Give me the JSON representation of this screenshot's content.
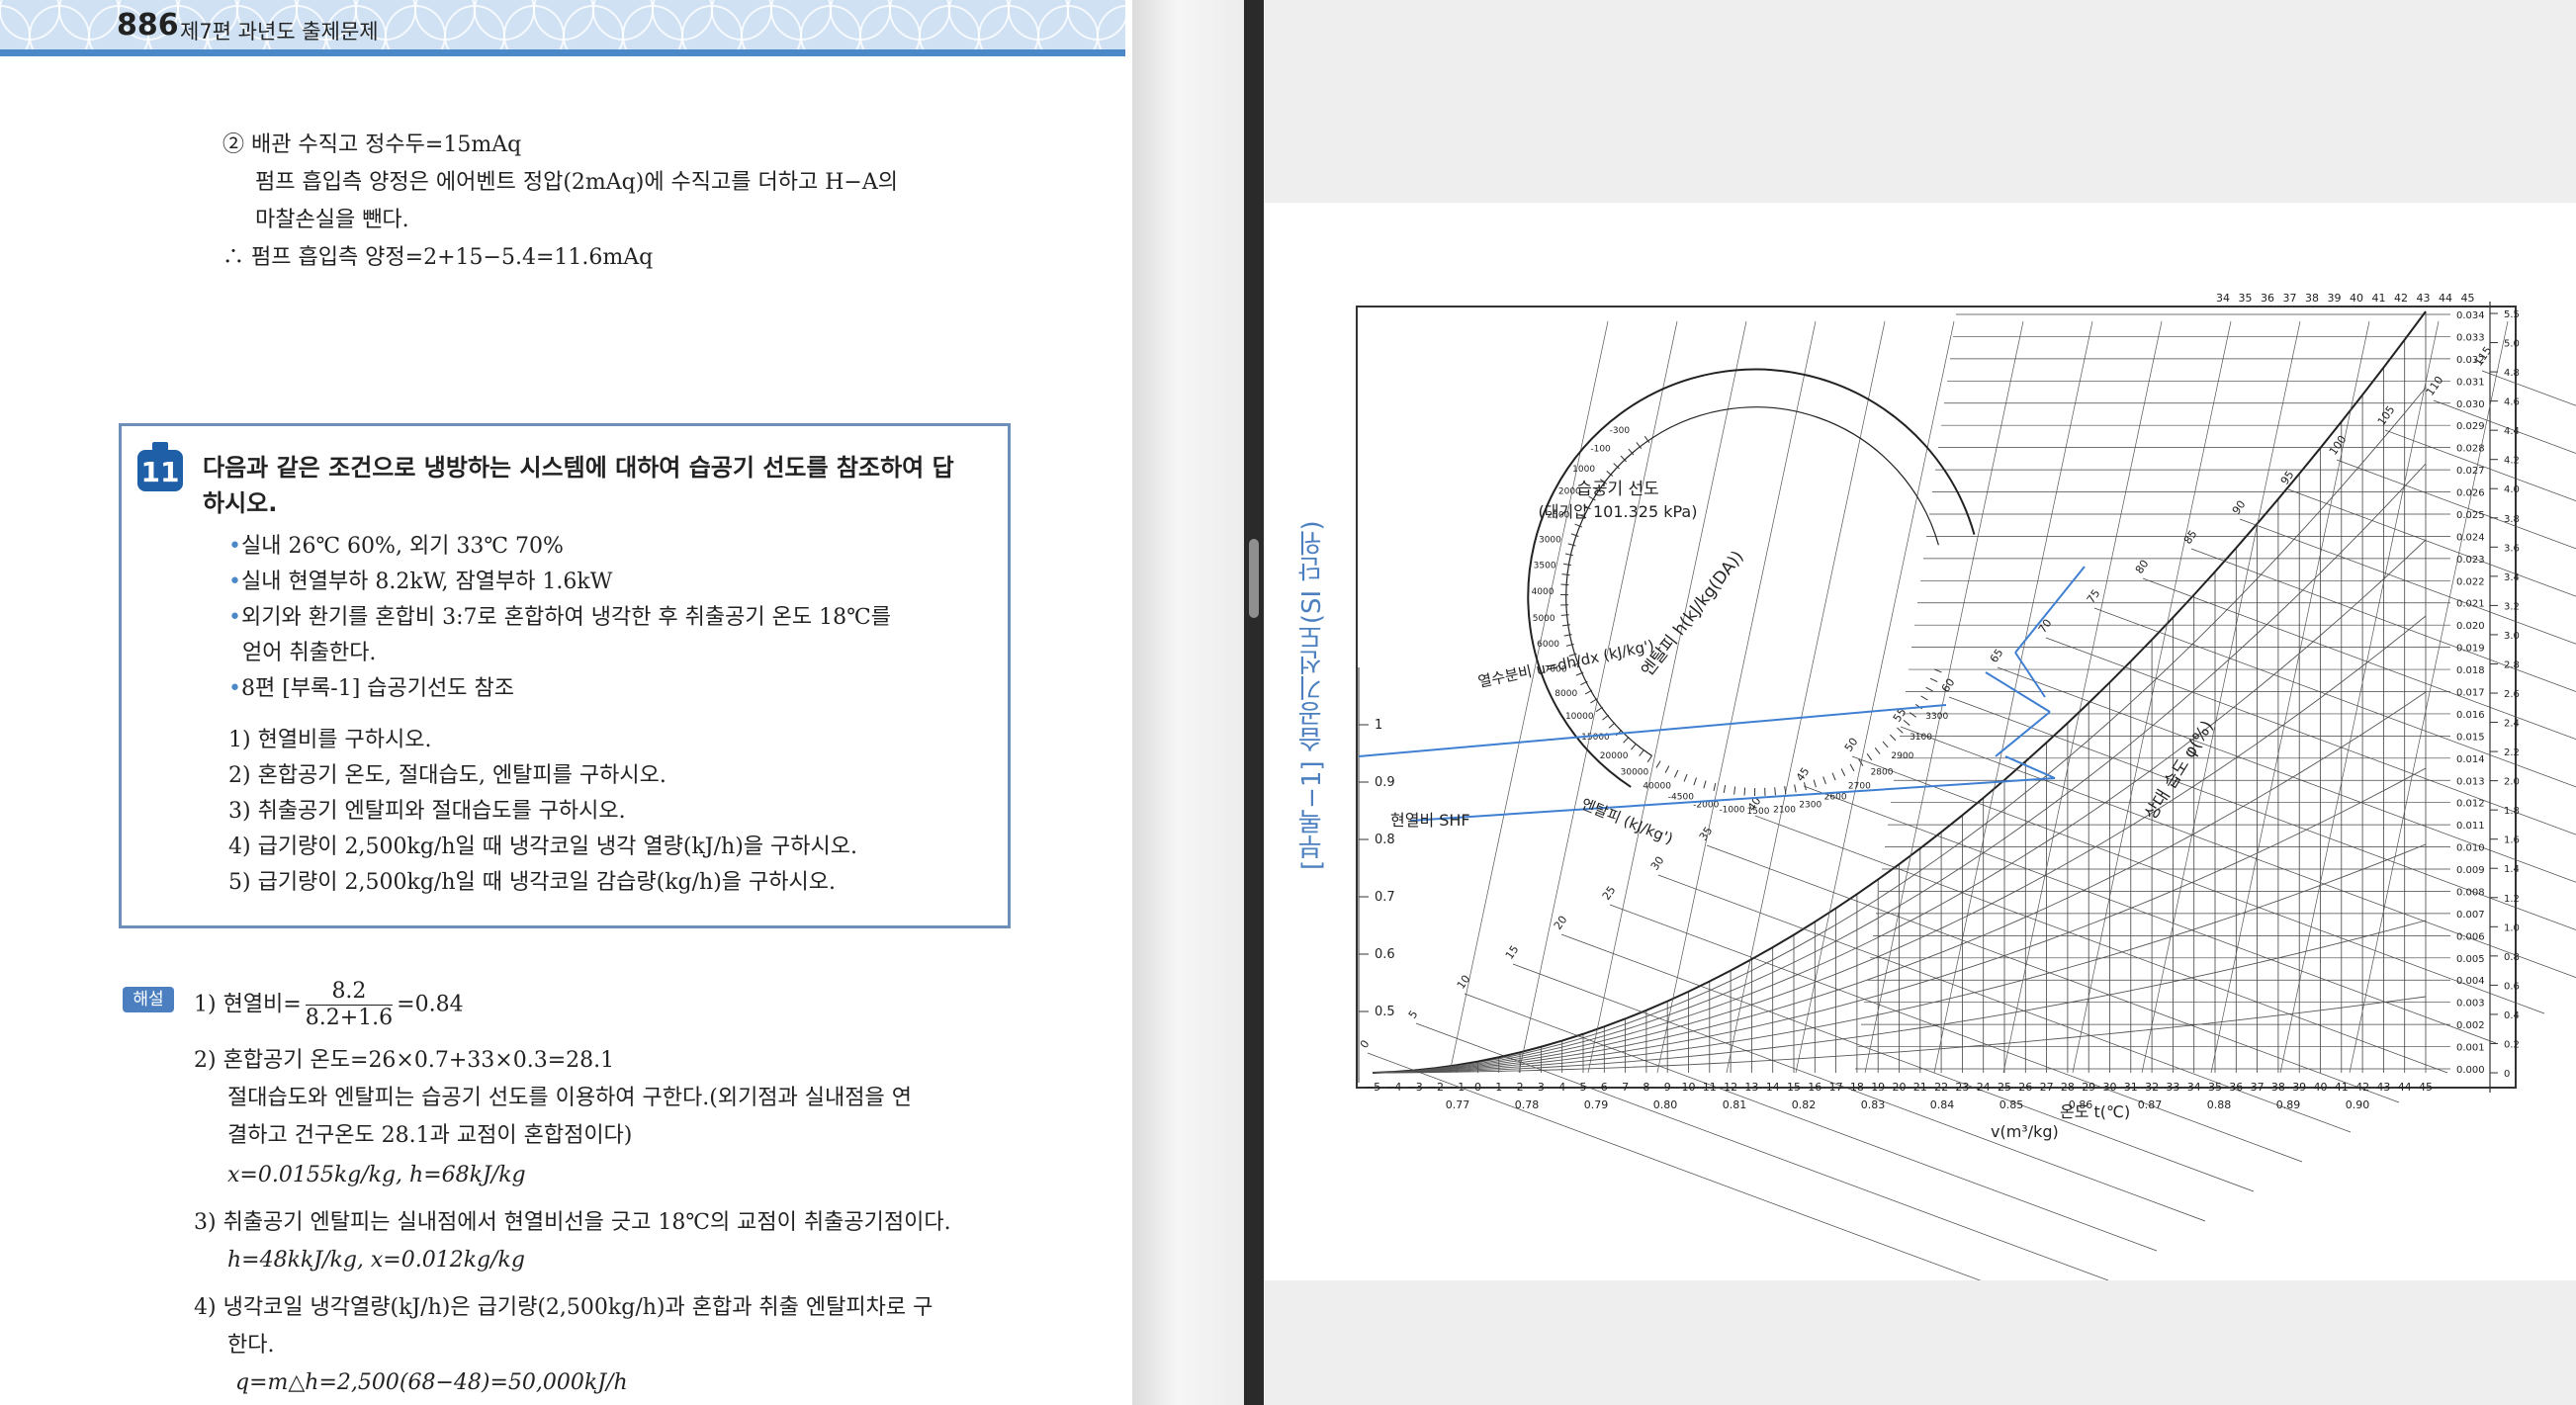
{
  "header": {
    "page_number": "886",
    "section": "제7편 과년도 출제문제"
  },
  "previous_solution": [
    "② 배관 수직고 정수두=15mAq",
    "펌프 흡입측 양정은 에어벤트 정압(2mAq)에 수직고를 더하고 H−A의",
    "마찰손실을 뺀다.",
    "∴ 펌프 흡입측 양정=2+15−5.4=11.6mAq"
  ],
  "problem": {
    "number": "11",
    "title_line1": "다음과 같은 조건으로 냉방하는 시스템에 대하여 습공기 선도를 참조하여 답",
    "title_line2": "하시오.",
    "conditions": [
      "실내 26℃ 60%, 외기 33℃ 70%",
      "실내 현열부하 8.2kW, 잠열부하 1.6kW",
      "외기와 환기를 혼합비 3:7로 혼합하여 냉각한 후 취출공기 온도 18℃를",
      "얻어 취출한다.",
      "8편 [부록-1] 습공기선도 참조"
    ],
    "questions": [
      "1) 현열비를 구하시오.",
      "2) 혼합공기 온도, 절대습도, 엔탈피를 구하시오.",
      "3) 취출공기 엔탈피와 절대습도를 구하시오.",
      "4) 급기량이 2,500kg/h일 때 냉각코일 냉각 열량(kJ/h)을 구하시오.",
      "5) 급기량이 2,500kg/h일 때 냉각코일 감습량(kg/h)을 구하시오."
    ]
  },
  "solution": {
    "badge": "해설",
    "s1_prefix": "1) 현열비=",
    "s1_num": "8.2",
    "s1_den": "8.2+1.6",
    "s1_result": "=0.84",
    "s2_line1": "2) 혼합공기 온도=26×0.7+33×0.3=28.1",
    "s2_line2": "절대습도와 엔탈피는 습공기 선도를 이용하여 구한다.(외기점과 실내점을 연",
    "s2_line3": "결하고 건구온도 28.1과 교점이 혼합점이다)",
    "s2_line4": "x=0.0155kg/kg, h=68kJ/kg",
    "s3_line1": "3) 취출공기 엔탈피는 실내점에서 현열비선을 긋고 18℃의 교점이 취출공기점이다.",
    "s3_line2": "h=48kkJ/kg, x=0.012kg/kg",
    "s4_line1": "4) 냉각코일 냉각열량(kJ/h)은 급기량(2,500kg/h)과 혼합과 취출 엔탈피차로 구",
    "s4_line2": "한다.",
    "s4_line3": "q=m△h=2,500(68−48)=50,000kJ/h"
  },
  "chart_page": {
    "side_label": "[부록−1] 습공기선도(SI 단위)",
    "title": "습공기 선도",
    "subtitle": "(대기압 101.325 kPa)",
    "x_axis_label": "온도 t(℃)",
    "v_axis_label": "v(m³/kg)",
    "enthalpy_label": "엔탈피 h(kJ/kg(DA))",
    "moisture_ratio_label": "열수분비 u=dh/dx (kJ/kg')",
    "shf_label": "현열비 SHF",
    "enthalpy_scale_label": "엔탈피 (kJ/kg')",
    "rh_label": "상대 습도 φ(%)",
    "x_ticks": [
      "−5",
      "−4",
      "−3",
      "−2",
      "−1",
      "0",
      "1",
      "2",
      "3",
      "4",
      "5",
      "6",
      "7",
      "8",
      "9",
      "10",
      "11",
      "12",
      "13",
      "14",
      "15",
      "16",
      "17",
      "18",
      "19",
      "20",
      "21",
      "22",
      "23",
      "24",
      "25",
      "26",
      "27",
      "28",
      "29",
      "30",
      "31",
      "32",
      "33",
      "34",
      "35",
      "36",
      "37",
      "38",
      "39",
      "40",
      "41",
      "42",
      "43",
      "44",
      "45"
    ],
    "v_ticks": [
      "0.77",
      "0.78",
      "0.79",
      "0.80",
      "0.81",
      "0.82",
      "0.83",
      "0.84",
      "0.85",
      "0.86",
      "0.87",
      "0.88",
      "0.89",
      "0.90"
    ],
    "x_right_ticks": [
      "0.034",
      "0.033",
      "0.032",
      "0.031",
      "0.030",
      "0.029",
      "0.028",
      "0.027",
      "0.026",
      "0.025",
      "0.024",
      "0.023",
      "0.022",
      "0.021",
      "0.020",
      "0.019",
      "0.018",
      "0.017",
      "0.016",
      "0.015",
      "0.014",
      "0.013",
      "0.012",
      "0.011",
      "0.010",
      "0.009",
      "0.008",
      "0.007",
      "0.006",
      "0.005",
      "0.004",
      "0.003",
      "0.002",
      "0.001",
      "0.000"
    ],
    "pw_ticks": [
      "5.5",
      "5.0",
      "4.8",
      "4.6",
      "4.4",
      "4.2",
      "4.0",
      "3.8",
      "3.6",
      "3.4",
      "3.2",
      "3.0",
      "2.8",
      "2.6",
      "2.4",
      "2.2",
      "2.0",
      "1.8",
      "1.6",
      "1.4",
      "1.2",
      "1.0",
      "0.8",
      "0.6",
      "0.4",
      "0.2",
      "0"
    ],
    "shf_ticks": [
      "1",
      "0.9",
      "0.8",
      "0.7",
      "0.6",
      "0.5"
    ],
    "enthalpy_ticks": [
      "0",
      "5",
      "10",
      "15",
      "20",
      "25",
      "30",
      "35",
      "40",
      "45",
      "50",
      "55",
      "60",
      "65",
      "70",
      "75",
      "80",
      "85",
      "90",
      "95",
      "100",
      "105",
      "110",
      "115"
    ],
    "top_ticks": [
      "34",
      "35",
      "36",
      "37",
      "38",
      "39",
      "40",
      "41",
      "42",
      "43",
      "44",
      "45"
    ],
    "protractor_ticks": [
      "-300",
      "-100",
      "1000",
      "2000",
      "2500",
      "3000",
      "3500",
      "4000",
      "5000",
      "6000",
      "7000",
      "8000",
      "10000",
      "15000",
      "20000",
      "30000",
      "40000",
      "-4500",
      "-2000",
      "-1000",
      "1500",
      "2100",
      "2300",
      "2600",
      "2700",
      "2800",
      "2900",
      "3100",
      "3300"
    ]
  }
}
